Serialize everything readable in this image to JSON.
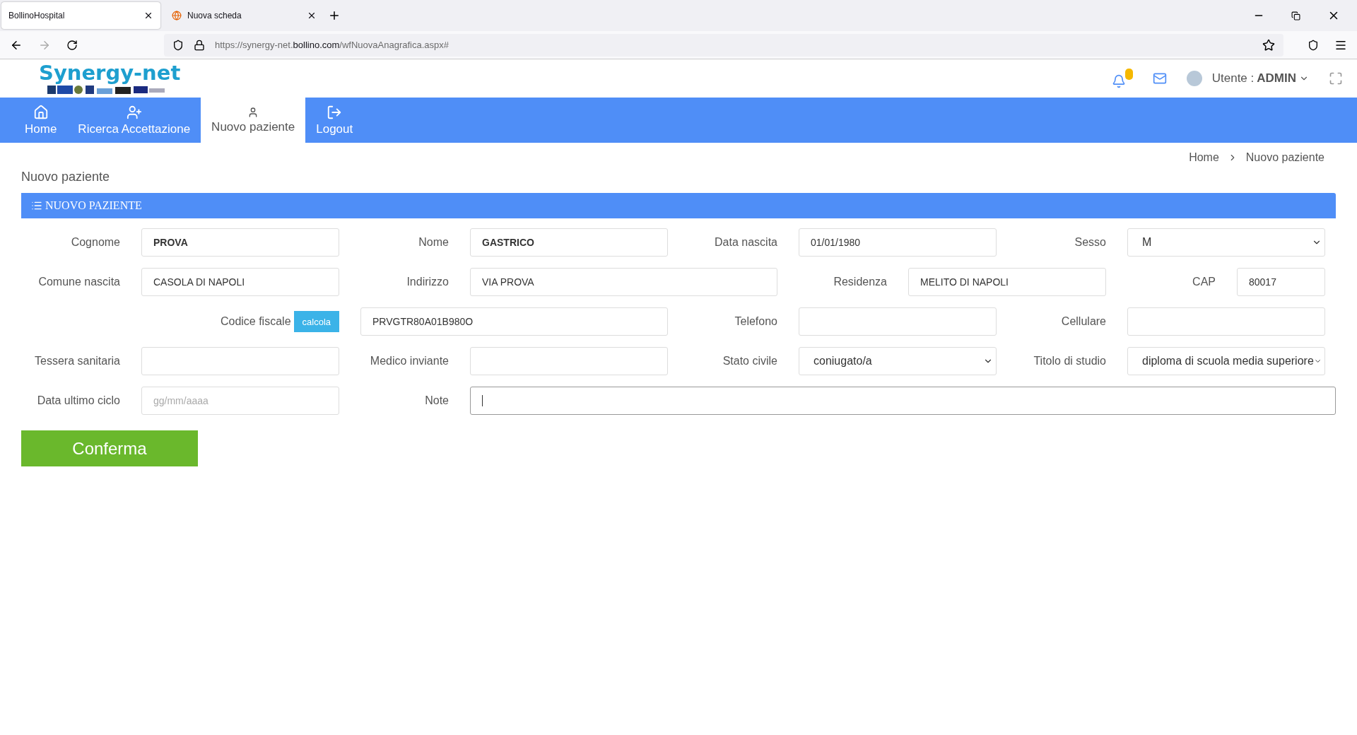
{
  "browser": {
    "tabs": [
      {
        "title": "BollinoHospital",
        "selected": true,
        "favicon": false
      },
      {
        "title": "Nuova scheda",
        "selected": false,
        "favicon": true
      }
    ],
    "address": {
      "prefix": "https://synergy-net.",
      "domain": "bollino.com",
      "suffix": "/wfNuovaAnagrafica.aspx#"
    }
  },
  "header": {
    "logo": "Synergy-net",
    "notifications": true,
    "user_label": "Utente : ",
    "user_name": "ADMIN"
  },
  "nav": [
    {
      "label": "Home",
      "selected": false
    },
    {
      "label": "Ricerca Accettazione",
      "selected": false
    },
    {
      "label": "Nuovo paziente",
      "selected": true
    },
    {
      "label": "Logout",
      "selected": false
    }
  ],
  "breadcrumb": [
    "Home",
    "Nuovo paziente"
  ],
  "page_title": "Nuovo paziente",
  "panel_title": "NUOVO PAZIENTE",
  "form_rows": [
    [
      {
        "label": "Cognome",
        "kind": "text",
        "value": "PROVA",
        "bold": true
      },
      {
        "label": "Nome",
        "kind": "text",
        "value": "GASTRICO",
        "bold": true
      },
      {
        "label": "Data nascita",
        "kind": "text",
        "value": "01/01/1980",
        "bold": false
      },
      {
        "label": "Sesso",
        "kind": "select",
        "value": "M"
      }
    ],
    [
      {
        "label": "Comune nascita",
        "kind": "text",
        "value": "CASOLA DI NAPOLI",
        "bold": false
      },
      {
        "label": "Indirizzo",
        "kind": "text",
        "value": "VIA PROVA",
        "bold": false
      },
      {
        "label": "Residenza",
        "kind": "text",
        "value": "MELITO DI NAPOLI",
        "bold": false
      },
      {
        "label": "CAP",
        "kind": "text",
        "value": "80017",
        "bold": false
      }
    ],
    [
      {
        "label": "Codice fiscale",
        "kind": "text-with-button",
        "button": "calcola",
        "value": "PRVGTR80A01B980O",
        "bold": false
      },
      {
        "label": "Telefono",
        "kind": "text"
      },
      {
        "label": "Cellulare",
        "kind": "text"
      }
    ],
    [
      {
        "label": "Tessera sanitaria",
        "kind": "text"
      },
      {
        "label": "Medico inviante",
        "kind": "text"
      },
      {
        "label": "Stato civile",
        "kind": "select",
        "value": "coniugato/a"
      },
      {
        "label": "Titolo di studio",
        "kind": "select",
        "value": "diploma di scuola media superiore"
      }
    ],
    [
      {
        "label": "Data ultimo ciclo",
        "kind": "text",
        "placeholder": "gg/mm/aaaa",
        "bold": false
      },
      {
        "label": "Note",
        "kind": "text",
        "focused": true
      }
    ]
  ],
  "submit": "Conferma"
}
